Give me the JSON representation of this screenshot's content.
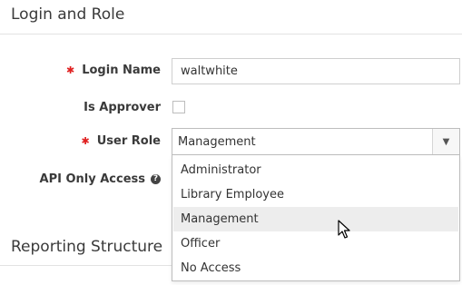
{
  "sections": {
    "login_title": "Login and Role",
    "reporting_title": "Reporting Structure"
  },
  "fields": {
    "login_name": {
      "label": "Login Name",
      "value": "waltwhite",
      "required": true
    },
    "is_approver": {
      "label": "Is Approver",
      "checked": false
    },
    "user_role": {
      "label": "User Role",
      "selected": "Management",
      "required": true,
      "options": [
        "Administrator",
        "Library Employee",
        "Management",
        "Officer",
        "No Access"
      ],
      "highlighted": "Management"
    },
    "api_only_access": {
      "label": "API Only Access",
      "help_icon": "question-circle-icon"
    }
  },
  "icons": {
    "required": "asterisk",
    "dropdown_arrow": "caret-down",
    "cursor": "mouse-pointer"
  }
}
